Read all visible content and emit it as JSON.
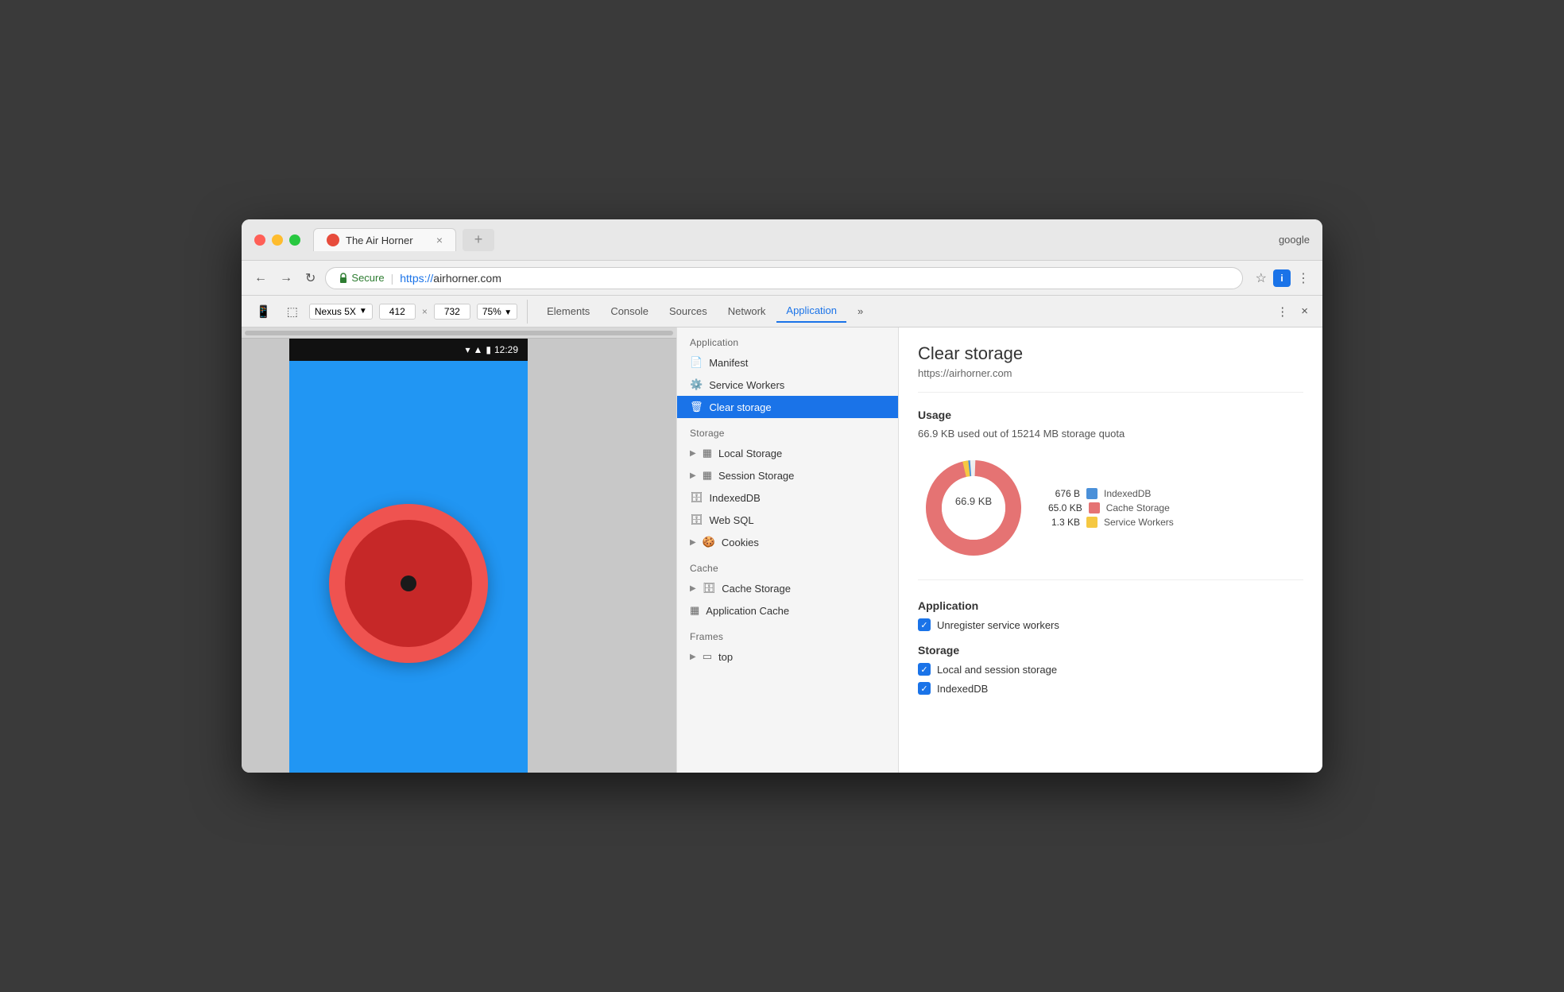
{
  "browser": {
    "title": "The Air Horner",
    "tab_close": "×",
    "google_profile": "google",
    "favicon_color": "#e74c3c"
  },
  "address_bar": {
    "secure_label": "Secure",
    "url_prefix": "https://",
    "url_domain": "airhorner.com"
  },
  "toolbar": {
    "device": "Nexus 5X",
    "width": "412",
    "height": "732",
    "zoom": "75%",
    "tabs": [
      "Elements",
      "Console",
      "Sources",
      "Network",
      "Application"
    ]
  },
  "phone": {
    "time": "12:29"
  },
  "sidebar": {
    "application_label": "Application",
    "items_app": [
      {
        "label": "Manifest",
        "icon": "📄"
      },
      {
        "label": "Service Workers",
        "icon": "⚙️"
      },
      {
        "label": "Clear storage",
        "icon": "🗑️",
        "active": true
      }
    ],
    "storage_label": "Storage",
    "items_storage": [
      {
        "label": "Local Storage",
        "icon": "▦",
        "arrow": true
      },
      {
        "label": "Session Storage",
        "icon": "▦",
        "arrow": true
      },
      {
        "label": "IndexedDB",
        "icon": "🗄️"
      },
      {
        "label": "Web SQL",
        "icon": "🗄️"
      },
      {
        "label": "Cookies",
        "icon": "🍪",
        "arrow": true
      }
    ],
    "cache_label": "Cache",
    "items_cache": [
      {
        "label": "Cache Storage",
        "icon": "🗄️",
        "arrow": true
      },
      {
        "label": "Application Cache",
        "icon": "▦"
      }
    ],
    "frames_label": "Frames",
    "items_frames": [
      {
        "label": "top",
        "icon": "▭",
        "arrow": true
      }
    ]
  },
  "panel": {
    "title": "Clear storage",
    "url": "https://airhorner.com",
    "usage_title": "Usage",
    "usage_text": "66.9 KB used out of 15214 MB storage quota",
    "donut_center": "66.9 KB",
    "legend": [
      {
        "label": "IndexedDB",
        "color": "#4A90D9",
        "value": "676 B"
      },
      {
        "label": "Cache Storage",
        "color": "#E57373",
        "value": "65.0 KB"
      },
      {
        "label": "Service Workers",
        "color": "#F5C842",
        "value": "1.3 KB"
      }
    ],
    "application_title": "Application",
    "checkboxes_app": [
      {
        "label": "Unregister service workers",
        "checked": true
      }
    ],
    "storage_title": "Storage",
    "checkboxes_storage": [
      {
        "label": "Local and session storage",
        "checked": true
      },
      {
        "label": "IndexedDB",
        "checked": true
      }
    ]
  }
}
